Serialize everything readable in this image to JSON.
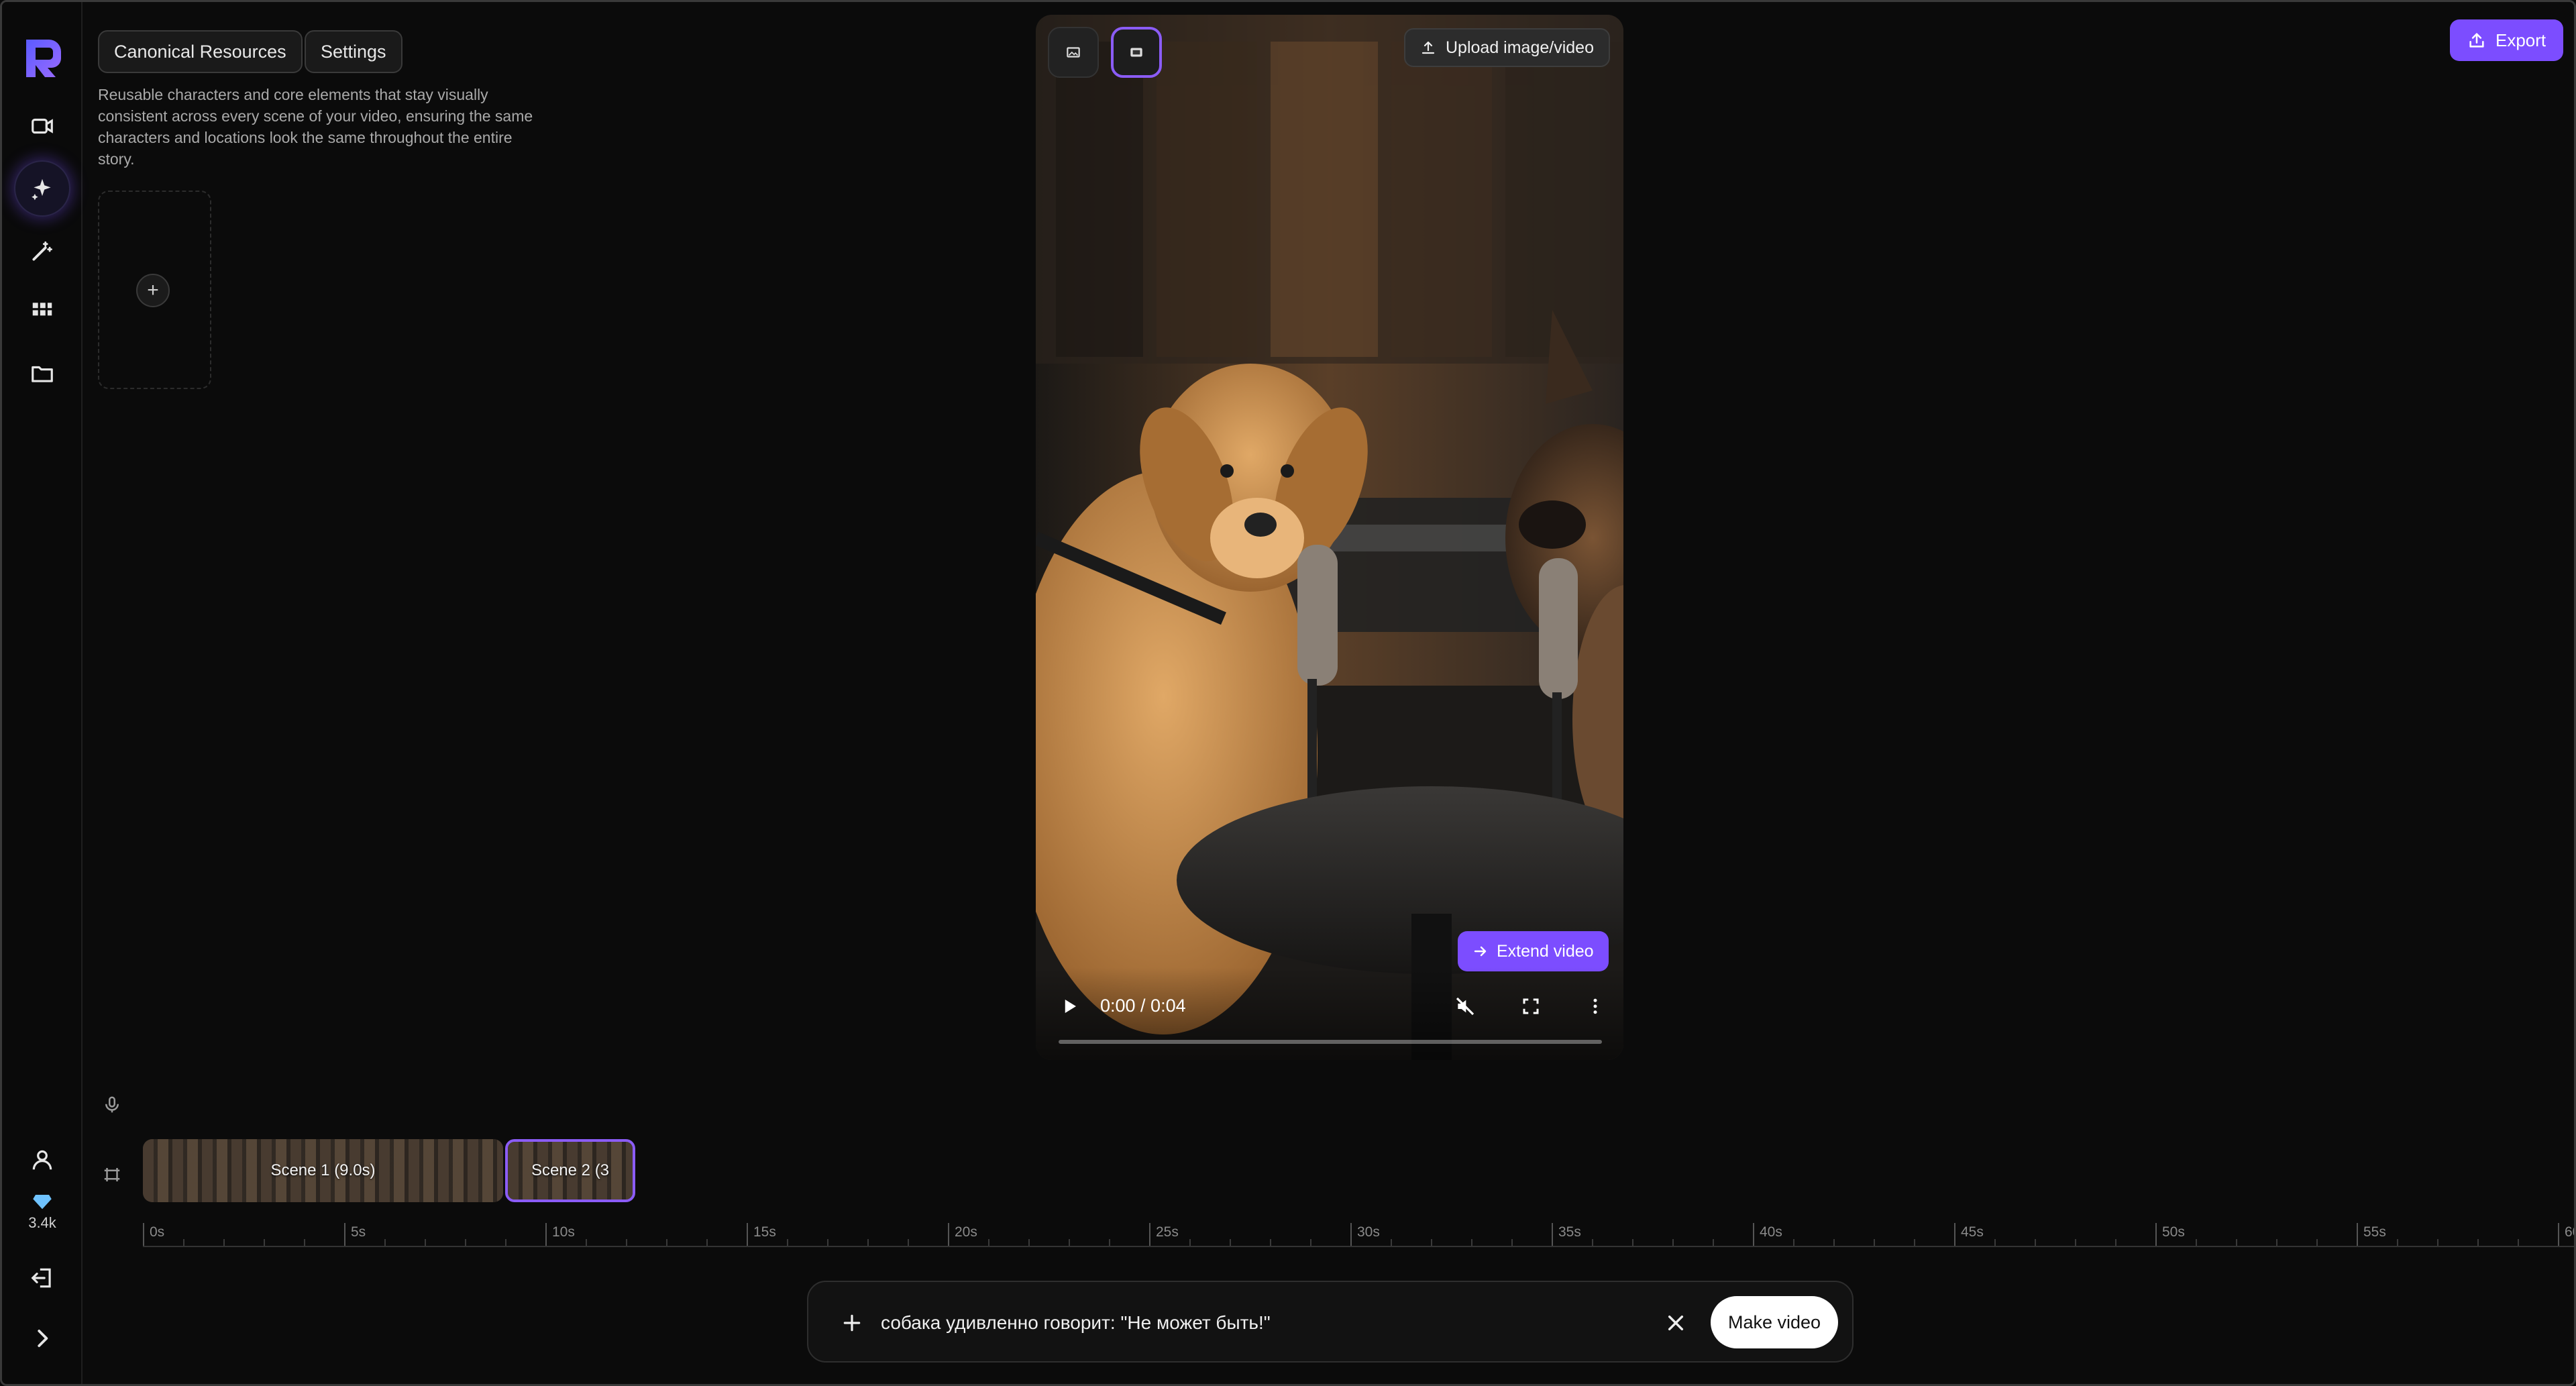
{
  "panel": {
    "tabs": [
      {
        "label": "Canonical Resources"
      },
      {
        "label": "Settings"
      }
    ],
    "description": "Reusable characters and core elements that stay visually consistent across every scene of your video, ensuring the same characters and locations look the same throughout the entire story.",
    "add_icon": "plus-icon"
  },
  "sidebar": {
    "items": [
      {
        "name": "video",
        "icon": "video-camera-icon"
      },
      {
        "name": "generate",
        "icon": "sparkle-icon",
        "active": true
      },
      {
        "name": "edit",
        "icon": "magic-wand-icon"
      },
      {
        "name": "apps",
        "icon": "grid-icon"
      },
      {
        "name": "files",
        "icon": "folder-icon"
      }
    ],
    "bottom": [
      {
        "name": "account",
        "icon": "user-icon"
      },
      {
        "name": "logout",
        "icon": "logout-icon"
      },
      {
        "name": "expand",
        "icon": "chevron-right-icon"
      }
    ],
    "credits": "3.4k",
    "accent": "#7c4dff"
  },
  "preview": {
    "upload_label": "Upload image/video",
    "extend_label": "Extend video",
    "time": "0:00 / 0:04",
    "progress": 0,
    "muted": true
  },
  "header": {
    "export_label": "Export"
  },
  "timeline": {
    "clips": [
      {
        "label": "Scene 1 (9.0s)"
      },
      {
        "label": "Scene 2 (3"
      }
    ],
    "ruler": [
      "0s",
      "5s",
      "10s",
      "15s",
      "20s",
      "25s",
      "30s",
      "35s",
      "40s",
      "45s",
      "50s",
      "55s",
      "60"
    ]
  },
  "prompt": {
    "value": "собака удивленно говорит: \"Не может быть!\"",
    "submit_label": "Make video"
  }
}
